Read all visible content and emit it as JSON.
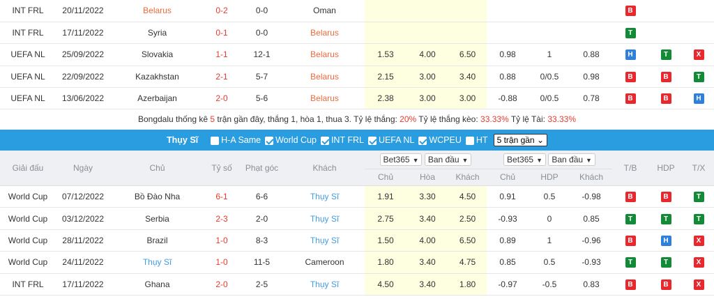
{
  "top_rows": [
    {
      "league": "INT FRL",
      "date": "20/11/2022",
      "home": "Belarus",
      "home_style": "red",
      "score": "0-2",
      "corner": "0-0",
      "away": "Oman",
      "away_style": "",
      "o1": "",
      "o2": "",
      "o3": "",
      "h1": "",
      "h2": "",
      "h3": "",
      "r1": "B",
      "r2": "",
      "r3": ""
    },
    {
      "league": "INT FRL",
      "date": "17/11/2022",
      "home": "Syria",
      "home_style": "",
      "score": "0-1",
      "corner": "0-0",
      "away": "Belarus",
      "away_style": "red",
      "o1": "",
      "o2": "",
      "o3": "",
      "h1": "",
      "h2": "",
      "h3": "",
      "r1": "T",
      "r2": "",
      "r3": ""
    },
    {
      "league": "UEFA NL",
      "date": "25/09/2022",
      "home": "Slovakia",
      "home_style": "",
      "score": "1-1",
      "corner": "12-1",
      "away": "Belarus",
      "away_style": "red",
      "o1": "1.53",
      "o2": "4.00",
      "o3": "6.50",
      "h1": "0.98",
      "h2": "1",
      "h3": "0.88",
      "r1": "H",
      "r2": "T",
      "r3": "X"
    },
    {
      "league": "UEFA NL",
      "date": "22/09/2022",
      "home": "Kazakhstan",
      "home_style": "",
      "score": "2-1",
      "corner": "5-7",
      "away": "Belarus",
      "away_style": "red",
      "o1": "2.15",
      "o2": "3.00",
      "o3": "3.40",
      "h1": "0.88",
      "h2": "0/0.5",
      "h3": "0.98",
      "r1": "B",
      "r2": "B",
      "r3": "T"
    },
    {
      "league": "UEFA NL",
      "date": "13/06/2022",
      "home": "Azerbaijan",
      "home_style": "",
      "score": "2-0",
      "corner": "5-6",
      "away": "Belarus",
      "away_style": "red",
      "o1": "2.38",
      "o2": "3.00",
      "o3": "3.00",
      "h1": "-0.88",
      "h2": "0/0.5",
      "h3": "0.78",
      "r1": "B",
      "r2": "B",
      "r3": "H"
    }
  ],
  "summary": {
    "p1": "Bongdalu thống kê ",
    "n": "5",
    "p2": " trận gần đây, thắng 1, hòa 1, thua 3. Tỷ lệ thắng: ",
    "win": "20%",
    "p3": " Tỷ lệ thắng kèo: ",
    "hdp": "33.33%",
    "p4": " Tỷ lệ Tài: ",
    "over": "33.33%"
  },
  "filter": {
    "team": "Thụy Sĩ",
    "opts": [
      {
        "label": "H-A Same",
        "on": false
      },
      {
        "label": "World Cup",
        "on": true
      },
      {
        "label": "INT FRL",
        "on": true
      },
      {
        "label": "UEFA NL",
        "on": true
      },
      {
        "label": "WCPEU",
        "on": true
      },
      {
        "label": "HT",
        "on": false
      }
    ],
    "select": "5 trận gần"
  },
  "header": {
    "league": "Giải đấu",
    "date": "Ngày",
    "home": "Chủ",
    "score": "Tỷ số",
    "corner": "Phạt góc",
    "away": "Khách",
    "bookmaker1": "Bet365",
    "type1": "Ban đầu",
    "bookmaker2": "Bet365",
    "type2": "Ban đầu",
    "tb": "T/B",
    "hdp": "HDP",
    "tx": "T/X",
    "sub": [
      "Chủ",
      "Hòa",
      "Khách",
      "Chủ",
      "HDP",
      "Khách"
    ]
  },
  "bottom_rows": [
    {
      "league": "World Cup",
      "date": "07/12/2022",
      "home": "Bồ Đào Nha",
      "home_style": "",
      "score": "6-1",
      "corner": "6-6",
      "away": "Thụy Sĩ",
      "away_style": "blue",
      "o1": "1.91",
      "o2": "3.30",
      "o3": "4.50",
      "h1": "0.91",
      "h2": "0.5",
      "h3": "-0.98",
      "r1": "B",
      "r2": "B",
      "r3": "T"
    },
    {
      "league": "World Cup",
      "date": "03/12/2022",
      "home": "Serbia",
      "home_style": "",
      "score": "2-3",
      "corner": "2-0",
      "away": "Thụy Sĩ",
      "away_style": "blue",
      "o1": "2.75",
      "o2": "3.40",
      "o3": "2.50",
      "h1": "-0.93",
      "h2": "0",
      "h3": "0.85",
      "r1": "T",
      "r2": "T",
      "r3": "T"
    },
    {
      "league": "World Cup",
      "date": "28/11/2022",
      "home": "Brazil",
      "home_style": "",
      "score": "1-0",
      "corner": "8-3",
      "away": "Thụy Sĩ",
      "away_style": "blue",
      "o1": "1.50",
      "o2": "4.00",
      "o3": "6.50",
      "h1": "0.89",
      "h2": "1",
      "h3": "-0.96",
      "r1": "B",
      "r2": "H",
      "r3": "X"
    },
    {
      "league": "World Cup",
      "date": "24/11/2022",
      "home": "Thụy Sĩ",
      "home_style": "blue",
      "score": "1-0",
      "corner": "11-5",
      "away": "Cameroon",
      "away_style": "",
      "o1": "1.80",
      "o2": "3.40",
      "o3": "4.75",
      "h1": "0.85",
      "h2": "0.5",
      "h3": "-0.93",
      "r1": "T",
      "r2": "T",
      "r3": "X"
    },
    {
      "league": "INT FRL",
      "date": "17/11/2022",
      "home": "Ghana",
      "home_style": "",
      "score": "2-0",
      "corner": "2-5",
      "away": "Thụy Sĩ",
      "away_style": "blue",
      "o1": "4.50",
      "o2": "3.40",
      "o3": "1.80",
      "h1": "-0.97",
      "h2": "-0.5",
      "h3": "0.83",
      "r1": "B",
      "r2": "B",
      "r3": "X"
    }
  ],
  "colors": {
    "accent": "#2a9de0",
    "red": "#e8282d",
    "green": "#138a36",
    "blue": "#2f7fdc"
  }
}
